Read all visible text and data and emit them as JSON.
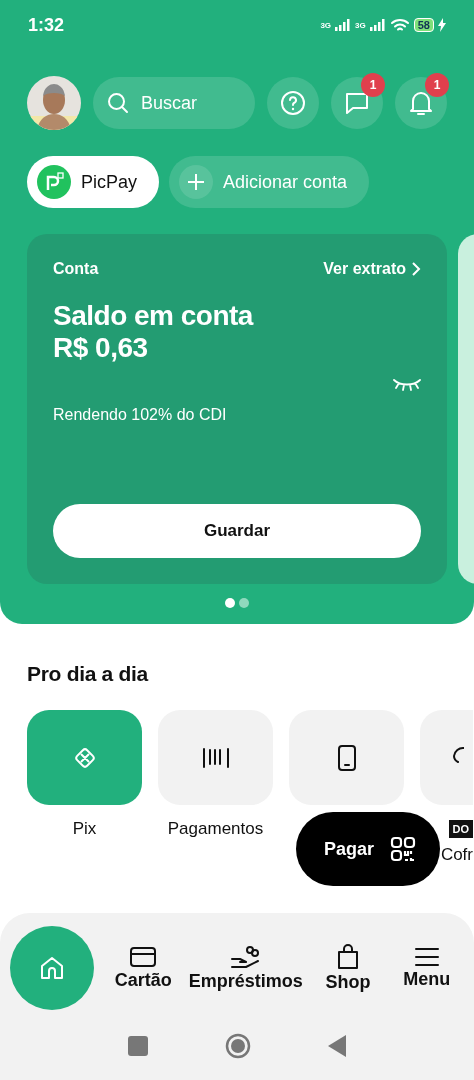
{
  "status_bar": {
    "time": "1:32",
    "network_labels": [
      "3G",
      "3G"
    ],
    "battery": "58"
  },
  "top_bar": {
    "search": {
      "placeholder": "Buscar"
    },
    "badges": [
      "1",
      "1"
    ]
  },
  "accounts": [
    {
      "label": "PicPay",
      "selected": true
    },
    {
      "label": "Adicionar conta",
      "selected": false
    }
  ],
  "account_card": {
    "title": "Conta",
    "link": "Ver extrato",
    "balance_label": "Saldo em conta",
    "balance": "R$ 0,63",
    "yield": "Rendendo 102% do CDI",
    "button": "Guardar"
  },
  "carousel_dots": [
    {
      "selected": true
    },
    {
      "selected": false
    }
  ],
  "section": {
    "title": "Pro dia a dia"
  },
  "shortcuts": [
    {
      "label": "Pix",
      "kind": "pix",
      "selected": true
    },
    {
      "label": "Pagamentos",
      "kind": "barcode",
      "selected": false
    },
    {
      "kind": "phone",
      "selected": false
    },
    {
      "label": "Cofr",
      "kind": "bulb",
      "selected": false,
      "tag": "DO"
    }
  ],
  "pay_button": {
    "label": "Pagar"
  },
  "bottom_nav": [
    {
      "kind": "home",
      "selected": true
    },
    {
      "label": "Cartão",
      "kind": "card",
      "selected": false
    },
    {
      "label": "Empréstimos",
      "kind": "loan",
      "selected": false
    },
    {
      "label": "Shop",
      "kind": "bag",
      "selected": false
    },
    {
      "label": "Menu",
      "kind": "menu",
      "selected": false
    }
  ]
}
